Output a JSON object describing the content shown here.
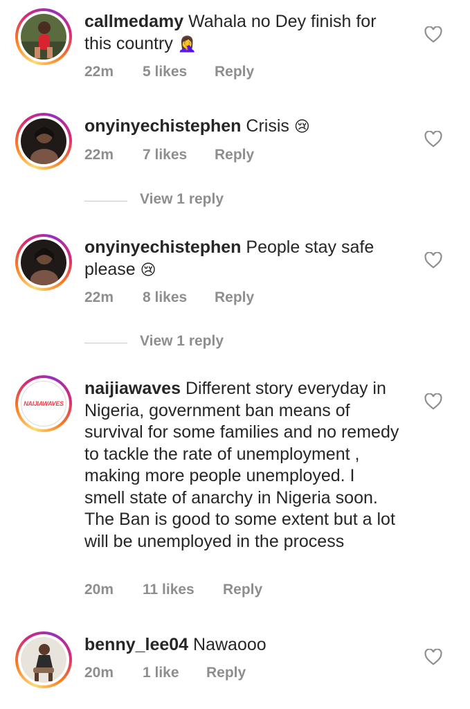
{
  "comments": [
    {
      "username": "callmedamy",
      "text": "Wahala no Dey finish for this country",
      "emoji": "🤦‍♀️",
      "time": "22m",
      "likes": "5 likes",
      "reply": "Reply"
    },
    {
      "username": "onyinyechistephen",
      "text": "Crisis",
      "emoji": "😢",
      "time": "22m",
      "likes": "7 likes",
      "reply": "Reply",
      "view_replies": "View 1 reply"
    },
    {
      "username": "onyinyechistephen",
      "text": "People stay safe please",
      "emoji": "😢",
      "time": "22m",
      "likes": "8 likes",
      "reply": "Reply",
      "view_replies": "View 1 reply"
    },
    {
      "username": "naijiawaves",
      "text": "Different story everyday in Nigeria, government ban means of survival for some families and no remedy to tackle the rate of unemployment , making more people unemployed. I smell state of anarchy in Nigeria soon. The Ban is good to some extent but a lot will be unemployed in the process",
      "avatar_logo_text": "NAIJIAWAVES",
      "time": "20m",
      "likes": "11 likes",
      "reply": "Reply"
    },
    {
      "username": "benny_lee04",
      "text": "Nawaooo",
      "time": "20m",
      "likes": "1 like",
      "reply": "Reply"
    }
  ],
  "icons": {
    "like": "heart-outline-icon"
  },
  "colors": {
    "text": "#262626",
    "secondary": "#8e8e8e",
    "ring_start": "#feda75",
    "ring_mid": "#d62976",
    "ring_end": "#962fbf"
  }
}
